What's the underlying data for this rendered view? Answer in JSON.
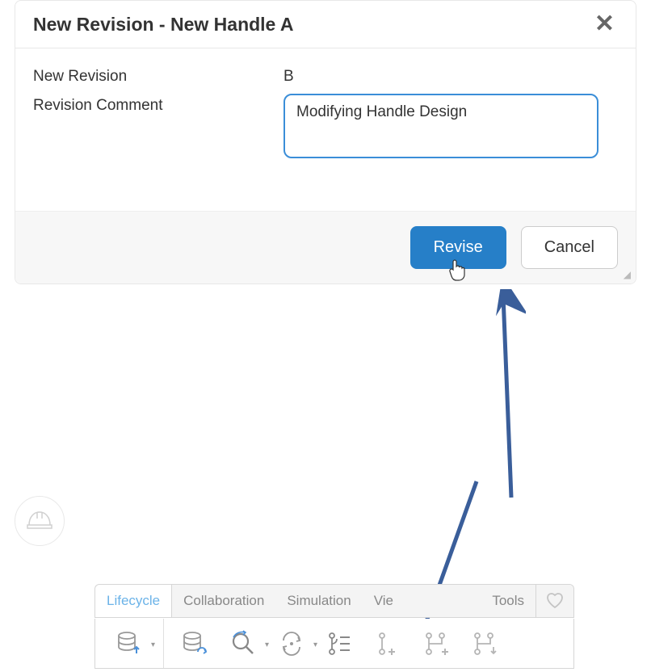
{
  "dialog": {
    "title": "New Revision - New Handle A",
    "fields": {
      "revision_label": "New Revision",
      "revision_value": "B",
      "comment_label": "Revision Comment",
      "comment_value": "Modifying Handle Design"
    },
    "buttons": {
      "revise": "Revise",
      "cancel": "Cancel"
    }
  },
  "tabs": {
    "lifecycle": "Lifecycle",
    "collaboration": "Collaboration",
    "simulation": "Simulation",
    "view": "Vie",
    "tools": "Tools"
  },
  "icons": {
    "close": "✕",
    "hardhat": "hardhat-icon",
    "heart": "heart-icon"
  }
}
